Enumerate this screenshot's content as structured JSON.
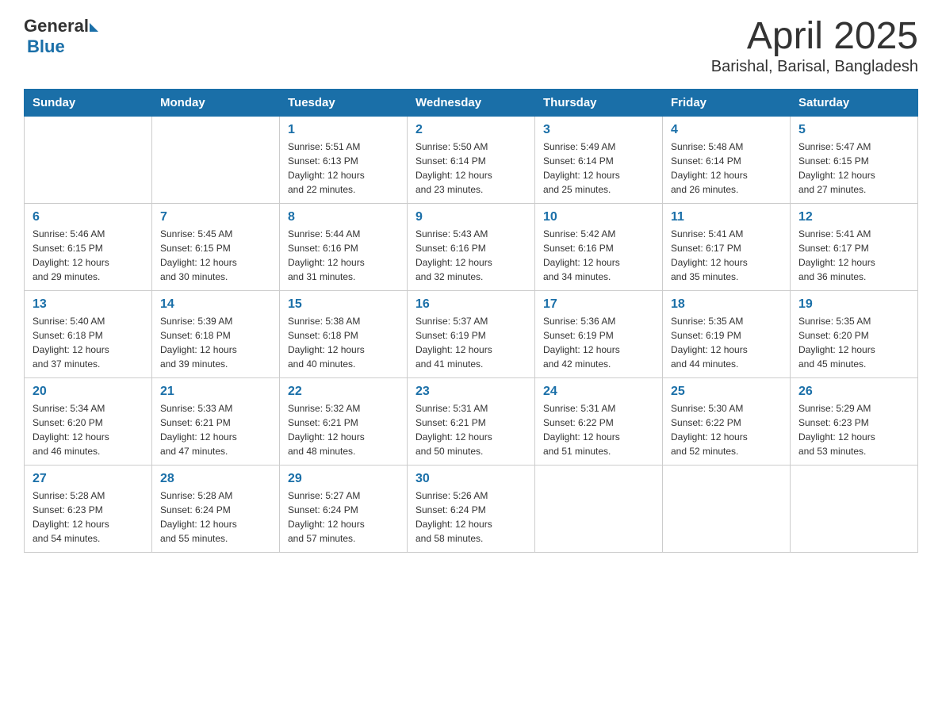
{
  "header": {
    "title": "April 2025",
    "subtitle": "Barishal, Barisal, Bangladesh"
  },
  "logo": {
    "general": "General",
    "blue": "Blue"
  },
  "weekdays": [
    "Sunday",
    "Monday",
    "Tuesday",
    "Wednesday",
    "Thursday",
    "Friday",
    "Saturday"
  ],
  "weeks": [
    [
      {
        "day": "",
        "info": ""
      },
      {
        "day": "",
        "info": ""
      },
      {
        "day": "1",
        "info": "Sunrise: 5:51 AM\nSunset: 6:13 PM\nDaylight: 12 hours\nand 22 minutes."
      },
      {
        "day": "2",
        "info": "Sunrise: 5:50 AM\nSunset: 6:14 PM\nDaylight: 12 hours\nand 23 minutes."
      },
      {
        "day": "3",
        "info": "Sunrise: 5:49 AM\nSunset: 6:14 PM\nDaylight: 12 hours\nand 25 minutes."
      },
      {
        "day": "4",
        "info": "Sunrise: 5:48 AM\nSunset: 6:14 PM\nDaylight: 12 hours\nand 26 minutes."
      },
      {
        "day": "5",
        "info": "Sunrise: 5:47 AM\nSunset: 6:15 PM\nDaylight: 12 hours\nand 27 minutes."
      }
    ],
    [
      {
        "day": "6",
        "info": "Sunrise: 5:46 AM\nSunset: 6:15 PM\nDaylight: 12 hours\nand 29 minutes."
      },
      {
        "day": "7",
        "info": "Sunrise: 5:45 AM\nSunset: 6:15 PM\nDaylight: 12 hours\nand 30 minutes."
      },
      {
        "day": "8",
        "info": "Sunrise: 5:44 AM\nSunset: 6:16 PM\nDaylight: 12 hours\nand 31 minutes."
      },
      {
        "day": "9",
        "info": "Sunrise: 5:43 AM\nSunset: 6:16 PM\nDaylight: 12 hours\nand 32 minutes."
      },
      {
        "day": "10",
        "info": "Sunrise: 5:42 AM\nSunset: 6:16 PM\nDaylight: 12 hours\nand 34 minutes."
      },
      {
        "day": "11",
        "info": "Sunrise: 5:41 AM\nSunset: 6:17 PM\nDaylight: 12 hours\nand 35 minutes."
      },
      {
        "day": "12",
        "info": "Sunrise: 5:41 AM\nSunset: 6:17 PM\nDaylight: 12 hours\nand 36 minutes."
      }
    ],
    [
      {
        "day": "13",
        "info": "Sunrise: 5:40 AM\nSunset: 6:18 PM\nDaylight: 12 hours\nand 37 minutes."
      },
      {
        "day": "14",
        "info": "Sunrise: 5:39 AM\nSunset: 6:18 PM\nDaylight: 12 hours\nand 39 minutes."
      },
      {
        "day": "15",
        "info": "Sunrise: 5:38 AM\nSunset: 6:18 PM\nDaylight: 12 hours\nand 40 minutes."
      },
      {
        "day": "16",
        "info": "Sunrise: 5:37 AM\nSunset: 6:19 PM\nDaylight: 12 hours\nand 41 minutes."
      },
      {
        "day": "17",
        "info": "Sunrise: 5:36 AM\nSunset: 6:19 PM\nDaylight: 12 hours\nand 42 minutes."
      },
      {
        "day": "18",
        "info": "Sunrise: 5:35 AM\nSunset: 6:19 PM\nDaylight: 12 hours\nand 44 minutes."
      },
      {
        "day": "19",
        "info": "Sunrise: 5:35 AM\nSunset: 6:20 PM\nDaylight: 12 hours\nand 45 minutes."
      }
    ],
    [
      {
        "day": "20",
        "info": "Sunrise: 5:34 AM\nSunset: 6:20 PM\nDaylight: 12 hours\nand 46 minutes."
      },
      {
        "day": "21",
        "info": "Sunrise: 5:33 AM\nSunset: 6:21 PM\nDaylight: 12 hours\nand 47 minutes."
      },
      {
        "day": "22",
        "info": "Sunrise: 5:32 AM\nSunset: 6:21 PM\nDaylight: 12 hours\nand 48 minutes."
      },
      {
        "day": "23",
        "info": "Sunrise: 5:31 AM\nSunset: 6:21 PM\nDaylight: 12 hours\nand 50 minutes."
      },
      {
        "day": "24",
        "info": "Sunrise: 5:31 AM\nSunset: 6:22 PM\nDaylight: 12 hours\nand 51 minutes."
      },
      {
        "day": "25",
        "info": "Sunrise: 5:30 AM\nSunset: 6:22 PM\nDaylight: 12 hours\nand 52 minutes."
      },
      {
        "day": "26",
        "info": "Sunrise: 5:29 AM\nSunset: 6:23 PM\nDaylight: 12 hours\nand 53 minutes."
      }
    ],
    [
      {
        "day": "27",
        "info": "Sunrise: 5:28 AM\nSunset: 6:23 PM\nDaylight: 12 hours\nand 54 minutes."
      },
      {
        "day": "28",
        "info": "Sunrise: 5:28 AM\nSunset: 6:24 PM\nDaylight: 12 hours\nand 55 minutes."
      },
      {
        "day": "29",
        "info": "Sunrise: 5:27 AM\nSunset: 6:24 PM\nDaylight: 12 hours\nand 57 minutes."
      },
      {
        "day": "30",
        "info": "Sunrise: 5:26 AM\nSunset: 6:24 PM\nDaylight: 12 hours\nand 58 minutes."
      },
      {
        "day": "",
        "info": ""
      },
      {
        "day": "",
        "info": ""
      },
      {
        "day": "",
        "info": ""
      }
    ]
  ]
}
